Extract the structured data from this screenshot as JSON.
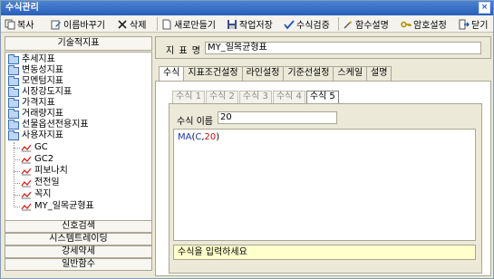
{
  "window": {
    "title": "수식관리",
    "close_label": "×"
  },
  "toolbar": {
    "copy": "복사",
    "rename": "이름바꾸기",
    "delete": "삭제",
    "new": "새로만들기",
    "save": "작업저장",
    "verify": "수식검증",
    "func_help": "함수설명",
    "password": "암호설정",
    "close": "닫기"
  },
  "left_panel": {
    "header": "기술적지표",
    "folders": [
      "추세지표",
      "변동성지표",
      "모멘텀지표",
      "시장강도지표",
      "가격지표",
      "거래량지표",
      "선물옵션전용지표",
      "사용자지표"
    ],
    "user_items": [
      "GC",
      "GC2",
      "피보나치",
      "전전일",
      "꼭지",
      "MY_일목균형표"
    ],
    "bottom_buttons": [
      "신호검색",
      "시스템트레이딩",
      "강세약세",
      "일반함수"
    ]
  },
  "indicator": {
    "label": "지 표 명",
    "value": "MY_일목균형표"
  },
  "tabs": [
    "수식",
    "지표조건설정",
    "라인설정",
    "기준선설정",
    "스케일",
    "설명"
  ],
  "active_tab": "수식",
  "subtabs": [
    "수식 1",
    "수식 2",
    "수식 3",
    "수식 4",
    "수식 5"
  ],
  "active_subtab": "수식 5",
  "formula": {
    "name_label": "수식 이름",
    "name_value": "20",
    "code_fn": "MA",
    "code_open": "(",
    "code_arg": "C",
    "code_comma": ",",
    "code_num": "20",
    "code_close": ")",
    "hint": "수식을 입력하세요"
  },
  "colors": {
    "titlebar": "#2a5fb9",
    "hint_bg": "#ffffcc",
    "code_fn": "#1a35b5",
    "code_num": "#c01010"
  }
}
